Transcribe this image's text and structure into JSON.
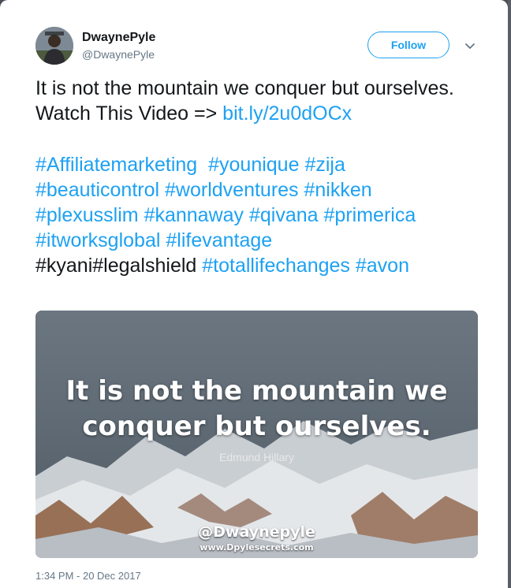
{
  "colors": {
    "accent": "#1da1f2",
    "text": "#14171a",
    "muted": "#657786"
  },
  "author": {
    "display_name": "DwaynePyle",
    "handle": "@DwaynePyle"
  },
  "header": {
    "follow_label": "Follow",
    "more_icon": "chevron-down-icon"
  },
  "tweet": {
    "line1": "It is not the mountain we conquer but ourselves.",
    "watch_prefix": "Watch This Video => ",
    "link": "bit.ly/2u0dOCx",
    "tags_row1": [
      "#Affiliatemarketing",
      "#younique",
      "#zija"
    ],
    "tags_row2": [
      "#beauticontrol",
      "#worldventures",
      "#nikken"
    ],
    "tags_row3": [
      "#plexusslim",
      "#kannaway",
      "#qivana",
      "#primerica"
    ],
    "tags_row4": [
      "#itworksglobal",
      "#lifevantage"
    ],
    "plain_row5": "#kyani#legalshield",
    "tags_row5": [
      "#totallifechanges",
      "#avon"
    ]
  },
  "media": {
    "quote": "It is not the mountain we conquer but ourselves.",
    "author": "Edmund Hillary",
    "watermark": "@Dwaynepyle",
    "website": "www.Dpylesecrets.com"
  },
  "timestamp": "1:34 PM - 20 Dec 2017"
}
